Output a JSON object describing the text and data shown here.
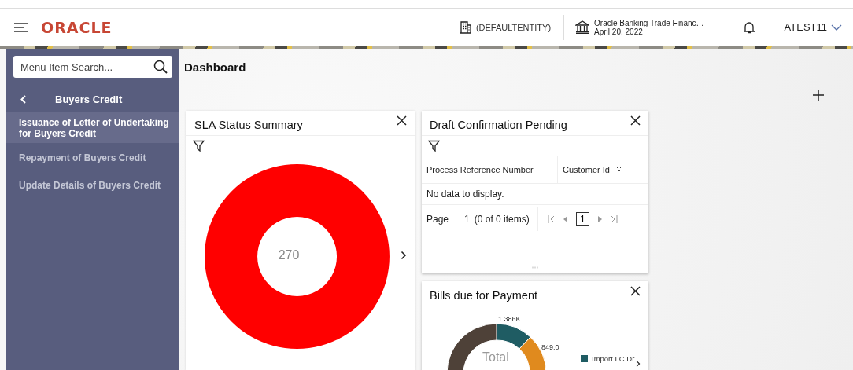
{
  "header": {
    "logo": "ORACLE",
    "entity": "(DEFAULTENTITY)",
    "bank_name": "Oracle Banking Trade Financ…",
    "date": "April 20, 2022",
    "user": "ATEST11"
  },
  "sidebar": {
    "search": {
      "placeholder": "Menu Item Search..."
    },
    "section": "Buyers Credit",
    "items": [
      {
        "label": "Issuance of Letter of Undertaking for Buyers Credit",
        "selected": true
      },
      {
        "label": "Repayment of Buyers Credit",
        "selected": false
      },
      {
        "label": "Update Details of Buyers Credit",
        "selected": false
      }
    ]
  },
  "page_title": "Dashboard",
  "widgets": [
    {
      "kind": "donut",
      "title": "SLA Status Summary",
      "center_label": "270",
      "color": "#ff0000"
    },
    {
      "kind": "table",
      "title": "Draft Confirmation Pending",
      "columns": [
        "Process Reference Number",
        "Customer Id"
      ],
      "empty_message": "No data to display.",
      "pagination": {
        "label": "Page",
        "page": "1",
        "summary": "(0 of 0 items)",
        "current": "1"
      }
    },
    {
      "kind": "pie",
      "title": "Bills due for Payment",
      "data_labels": [
        "1.386K",
        "849.0"
      ],
      "center_label": "Total",
      "legend": [
        {
          "label": "Import LC Dr..",
          "color": "#1f5c63"
        }
      ]
    }
  ]
}
